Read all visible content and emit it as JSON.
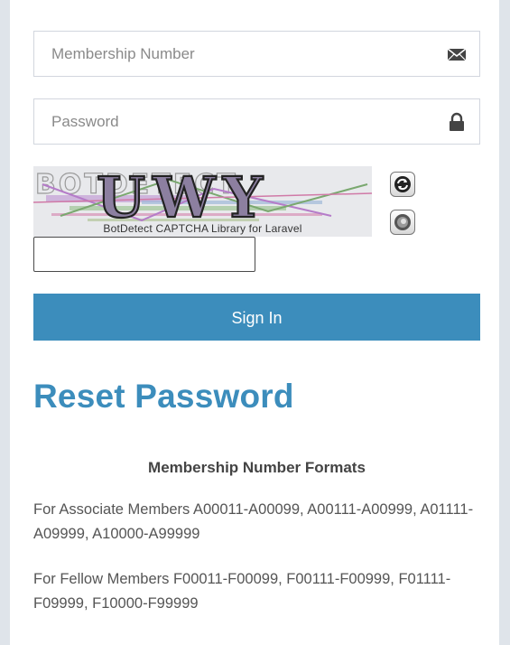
{
  "login_form": {
    "membership_placeholder": "Membership Number",
    "membership_icon": "envelope-icon",
    "password_placeholder": "Password",
    "password_icon": "lock-icon",
    "captcha": {
      "image_text": "UWY",
      "watermark": "BOTDETECT",
      "caption": "BotDetect CAPTCHA Library for Laravel",
      "reload_icon": "reload-icon",
      "sound_icon": "speaker-icon",
      "input_value": ""
    },
    "signin_label": "Sign In"
  },
  "reset_password_label": "Reset Password",
  "formats": {
    "title": "Membership Number Formats",
    "associate_text": "For Associate Members A00011-A00099, A00111-A00999, A01111-A09999, A10000-A99999",
    "fellow_text": "For Fellow Members F00011-F00099, F00111-F00999, F01111-F09999, F10000-F99999"
  },
  "colors": {
    "accent": "#3c8dbc",
    "background": "#dfe4ea",
    "card": "#ffffff"
  }
}
